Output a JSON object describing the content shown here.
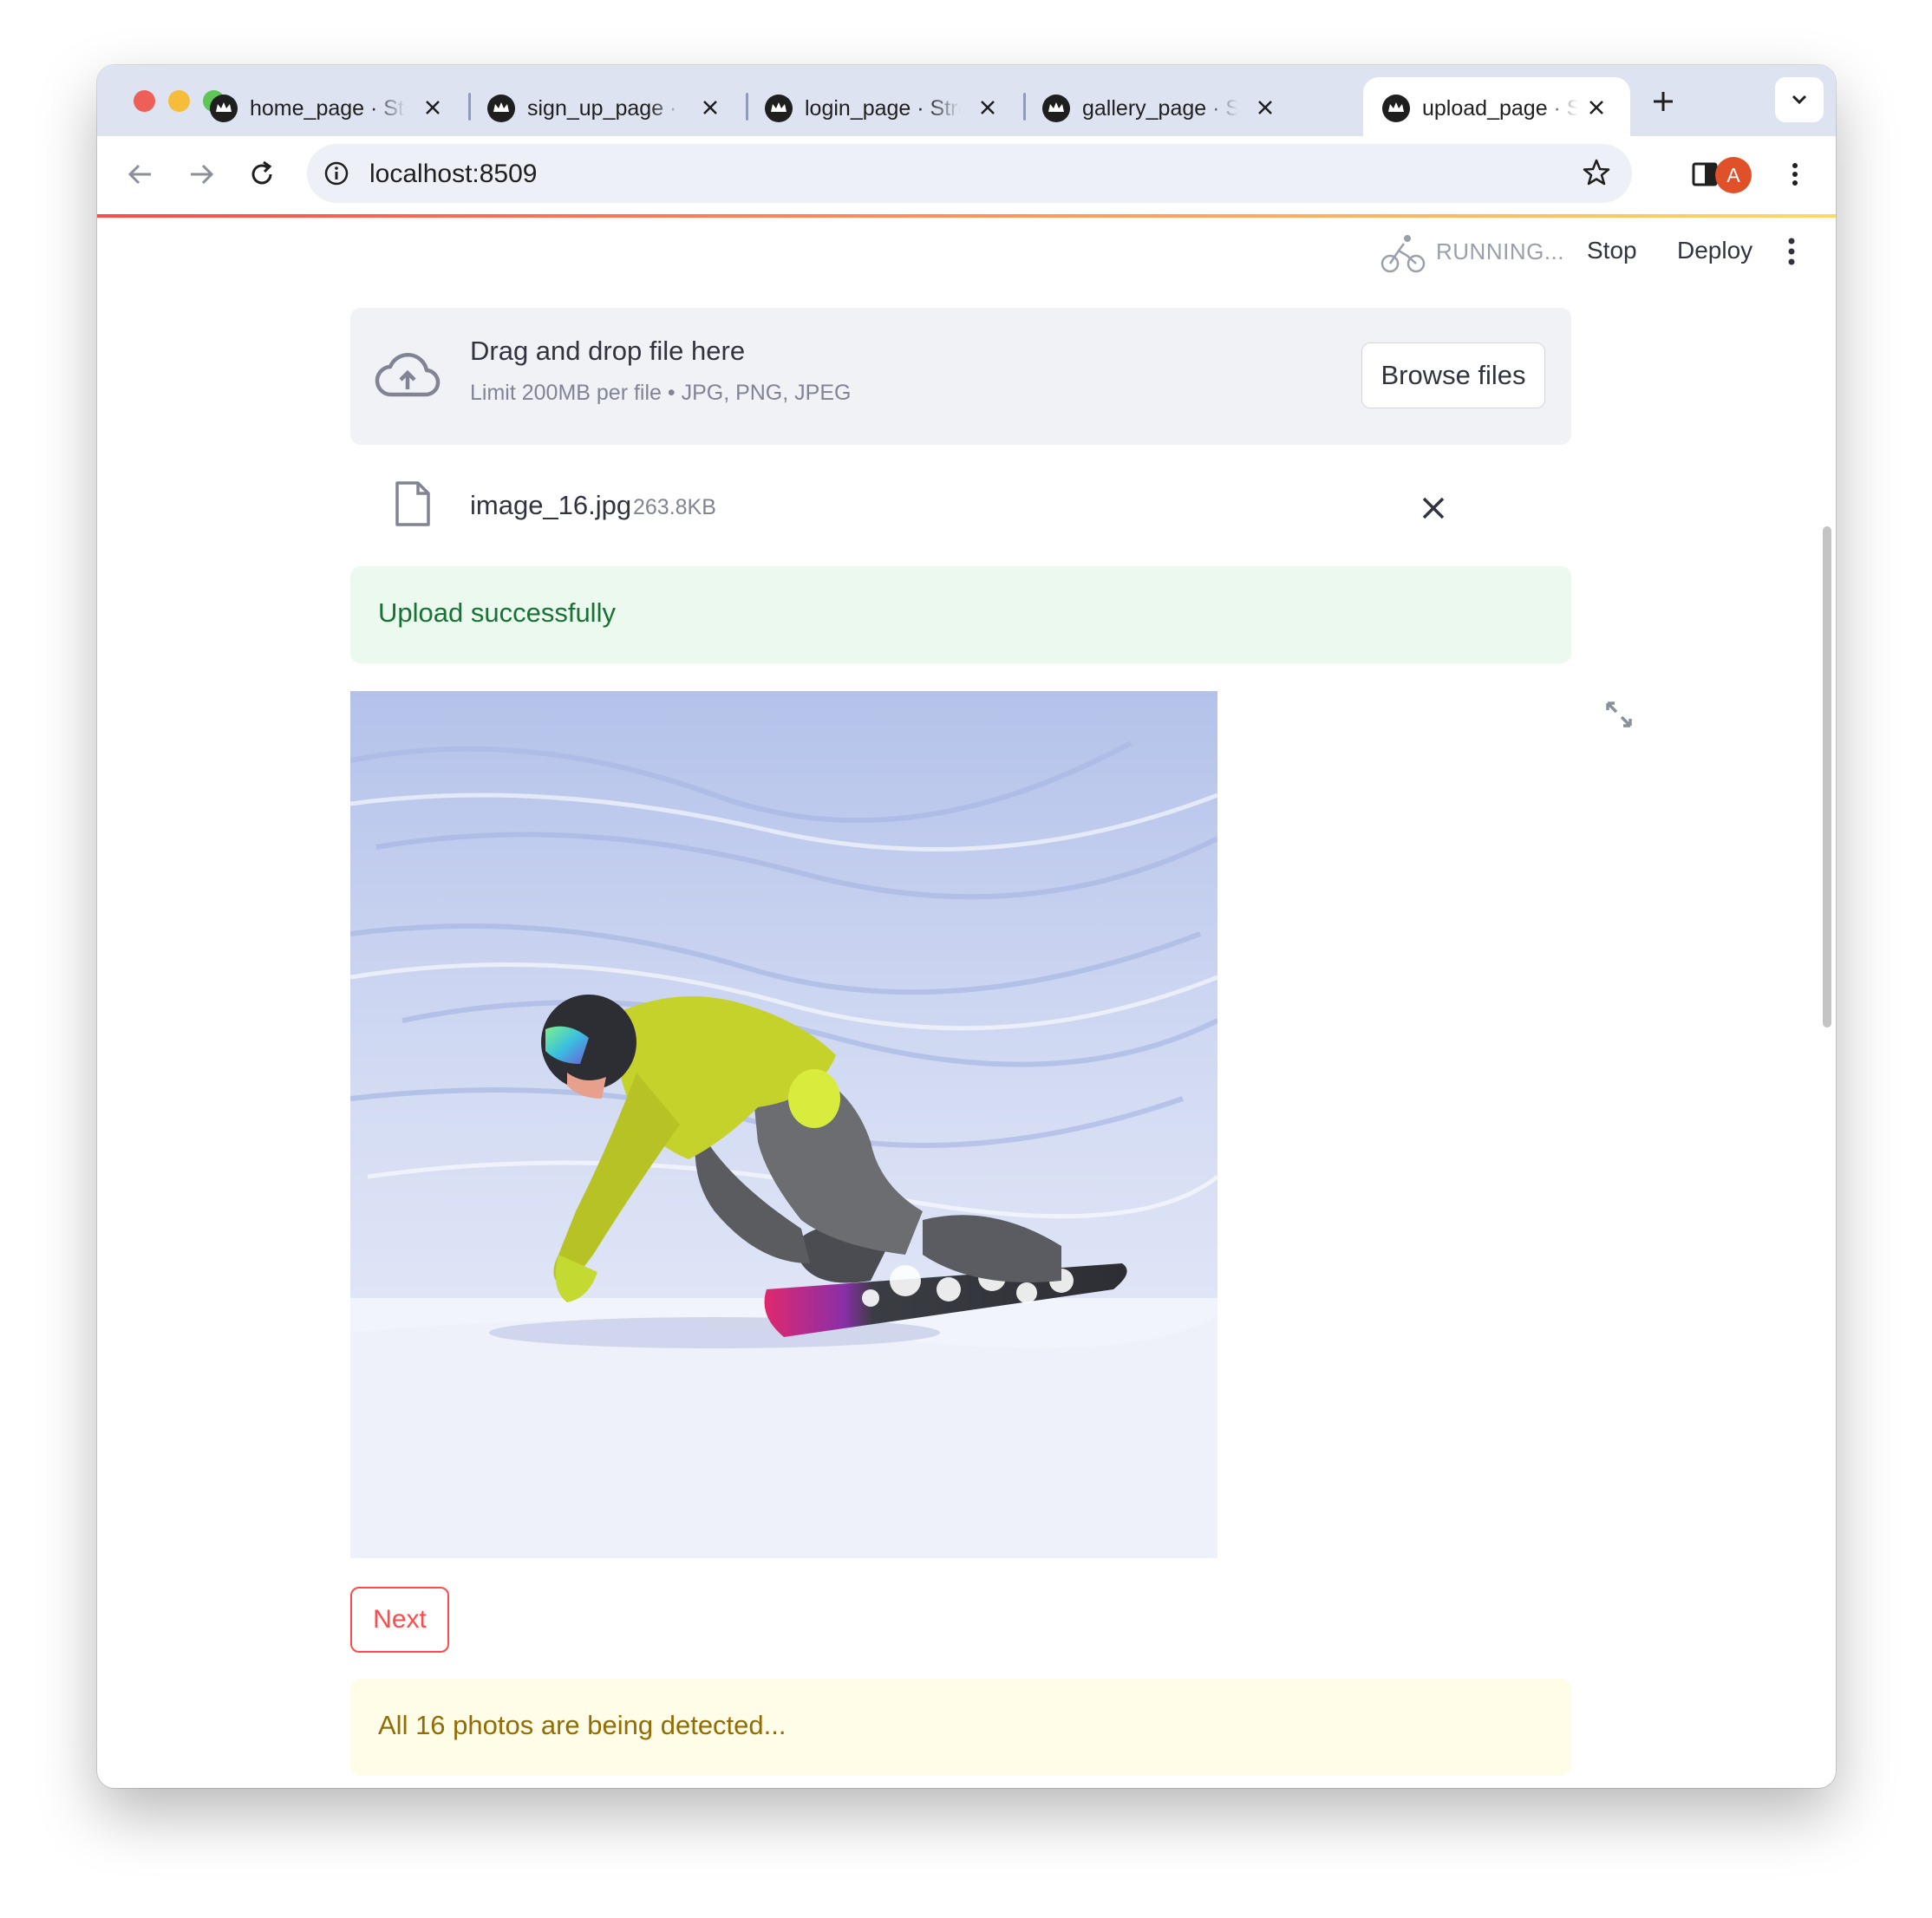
{
  "browser": {
    "tabs": [
      {
        "title": "home_page · Streamlit"
      },
      {
        "title": "sign_up_page · Streamlit"
      },
      {
        "title": "login_page · Streamlit"
      },
      {
        "title": "gallery_page · Streamlit"
      },
      {
        "title": "upload_page · Streamlit",
        "active": true
      }
    ],
    "url": "localhost:8509",
    "profile_initial": "A",
    "colors": {
      "tabstrip": "#dde3f1",
      "profile": "#e0512a"
    }
  },
  "app_header": {
    "status": "RUNNING...",
    "stop_label": "Stop",
    "deploy_label": "Deploy"
  },
  "uploader": {
    "title": "Drag and drop file here",
    "subtitle": "Limit 200MB per file • JPG, PNG, JPEG",
    "browse_label": "Browse files",
    "file": {
      "name": "image_16.jpg",
      "size": "263.8KB"
    }
  },
  "success_message": "Upload successfully",
  "image": {
    "description_icon": "snowboarder-photo"
  },
  "next_label": "Next",
  "warning_message": "All 16 photos are being detected...",
  "colors": {
    "primary": "#ff4b4b",
    "success_bg": "#ecf9ef",
    "success_text": "#177233",
    "warning_bg": "#fffce7",
    "warning_text": "#926c05"
  }
}
